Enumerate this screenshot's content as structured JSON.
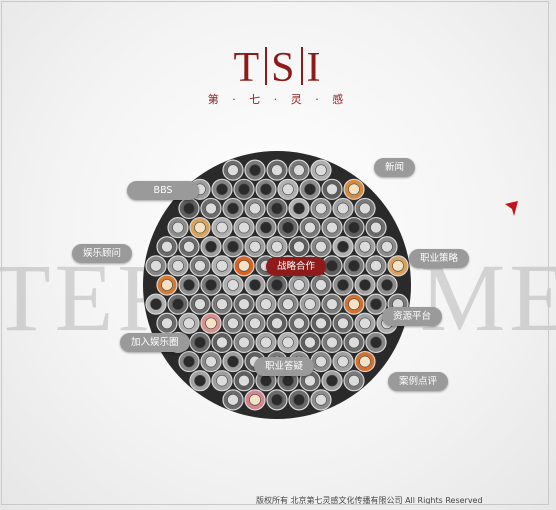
{
  "logo": {
    "letters": [
      "T",
      "S",
      "I"
    ]
  },
  "subtitle": "第 · 七 · 灵 · 感",
  "background_word": {
    "left": "TER",
    "right": "ME"
  },
  "nav": {
    "news": "新闻",
    "bbs": "BBS",
    "entertainment": "娱乐顾问",
    "strategic": "战略合作",
    "career_planning": "职业策略",
    "resource_platform": "资源平台",
    "join": "加入娱乐圈",
    "career_qa": "职业答疑",
    "case_review": "案例点评"
  },
  "footer": {
    "text": "版权所有  北京第七灵感文化传播有限公司  All Rights Reserved"
  },
  "colors": {
    "brand": "#8e1a1a",
    "pill": "#9a9a9a",
    "pill_active": "#8e1a1a"
  }
}
